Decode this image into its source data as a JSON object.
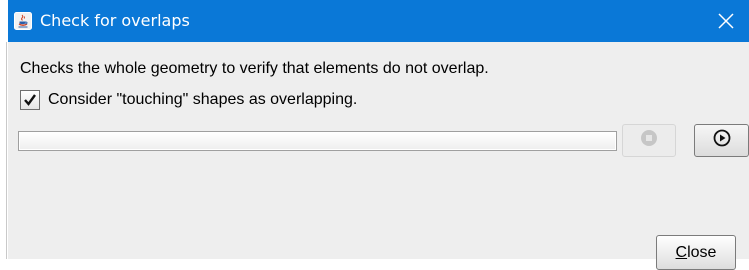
{
  "window": {
    "title": "Check for overlaps",
    "title_bar_color": "#0a78d7",
    "icon": "java-cup-icon",
    "close_icon": "close-icon"
  },
  "dialog": {
    "description": "Checks the whole geometry to verify that elements do not overlap.",
    "checkbox": {
      "label": "Consider \"touching\" shapes as overlapping.",
      "checked": true
    },
    "progress": {
      "value_percent": 0
    },
    "stop_button": {
      "icon": "stop-icon",
      "enabled": false
    },
    "run_button": {
      "icon": "play-icon",
      "enabled": true
    },
    "close_button": {
      "mnemonic": "C",
      "label_rest": "lose"
    }
  }
}
